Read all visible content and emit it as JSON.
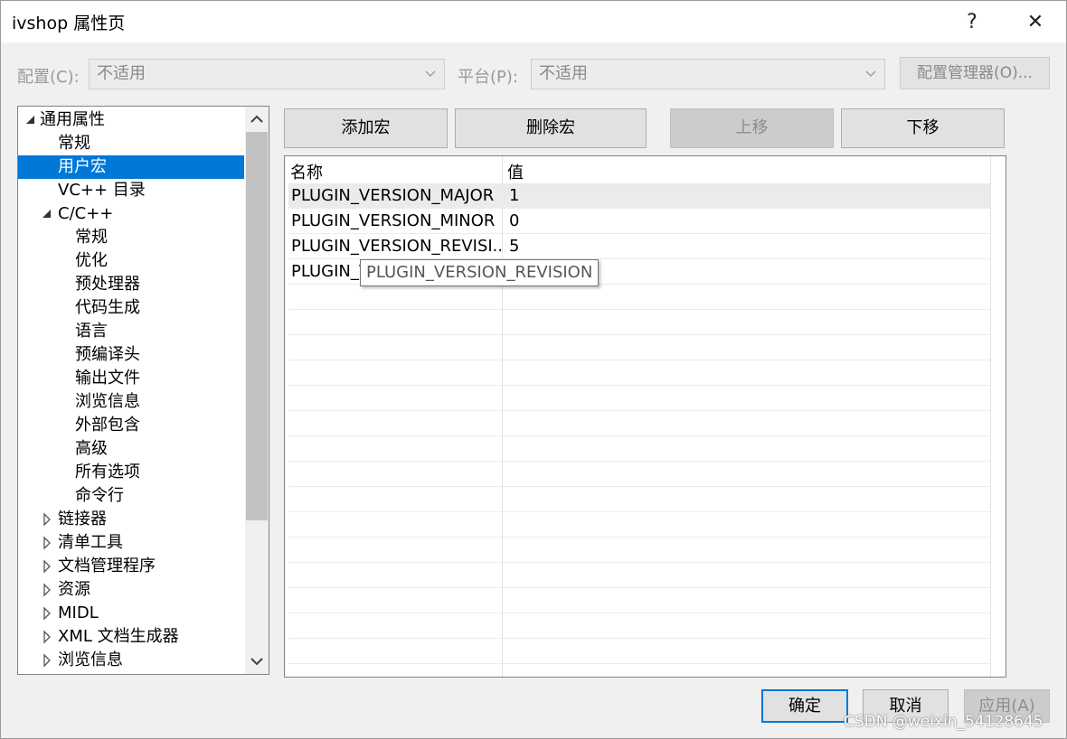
{
  "window": {
    "title": "ivshop 属性页",
    "help_glyph": "?",
    "close_glyph": "✕"
  },
  "config": {
    "config_label": "配置(C):",
    "config_value": "不适用",
    "platform_label": "平台(P):",
    "platform_value": "不适用",
    "manager_label": "配置管理器(O)..."
  },
  "tree": {
    "items": [
      {
        "label": "通用属性",
        "level": 0,
        "arrow": "expanded"
      },
      {
        "label": "常规",
        "level": 1,
        "arrow": "none"
      },
      {
        "label": "用户宏",
        "level": 1,
        "arrow": "none",
        "selected": true
      },
      {
        "label": "VC++ 目录",
        "level": 1,
        "arrow": "none"
      },
      {
        "label": "C/C++",
        "level": 1,
        "arrow": "expanded"
      },
      {
        "label": "常规",
        "level": 2,
        "arrow": "none"
      },
      {
        "label": "优化",
        "level": 2,
        "arrow": "none"
      },
      {
        "label": "预处理器",
        "level": 2,
        "arrow": "none"
      },
      {
        "label": "代码生成",
        "level": 2,
        "arrow": "none"
      },
      {
        "label": "语言",
        "level": 2,
        "arrow": "none"
      },
      {
        "label": "预编译头",
        "level": 2,
        "arrow": "none"
      },
      {
        "label": "输出文件",
        "level": 2,
        "arrow": "none"
      },
      {
        "label": "浏览信息",
        "level": 2,
        "arrow": "none"
      },
      {
        "label": "外部包含",
        "level": 2,
        "arrow": "none"
      },
      {
        "label": "高级",
        "level": 2,
        "arrow": "none"
      },
      {
        "label": "所有选项",
        "level": 2,
        "arrow": "none"
      },
      {
        "label": "命令行",
        "level": 2,
        "arrow": "none"
      },
      {
        "label": "链接器",
        "level": 1,
        "arrow": "collapsed"
      },
      {
        "label": "清单工具",
        "level": 1,
        "arrow": "collapsed"
      },
      {
        "label": "文档管理程序",
        "level": 1,
        "arrow": "collapsed"
      },
      {
        "label": "资源",
        "level": 1,
        "arrow": "collapsed"
      },
      {
        "label": "MIDL",
        "level": 1,
        "arrow": "collapsed"
      },
      {
        "label": "XML 文档生成器",
        "level": 1,
        "arrow": "collapsed"
      },
      {
        "label": "浏览信息",
        "level": 1,
        "arrow": "collapsed"
      }
    ]
  },
  "toolbar": {
    "add_label": "添加宏",
    "delete_label": "删除宏",
    "up_label": "上移",
    "down_label": "下移"
  },
  "grid": {
    "col_name": "名称",
    "col_value": "值",
    "rows": [
      {
        "name": "PLUGIN_VERSION_MAJOR",
        "value": "1",
        "highlight": true
      },
      {
        "name": "PLUGIN_VERSION_MINOR",
        "value": "0"
      },
      {
        "name": "PLUGIN_VERSION_REVISI...",
        "value": "5"
      },
      {
        "name": "PLUGIN_V",
        "value": ""
      }
    ],
    "tooltip": "PLUGIN_VERSION_REVISION"
  },
  "footer": {
    "ok_label": "确定",
    "cancel_label": "取消",
    "apply_label": "应用(A)"
  },
  "watermark": "CSDN @weixin_54128645",
  "colors": {
    "selection": "#0078d7",
    "primary_border": "#0078d7"
  }
}
